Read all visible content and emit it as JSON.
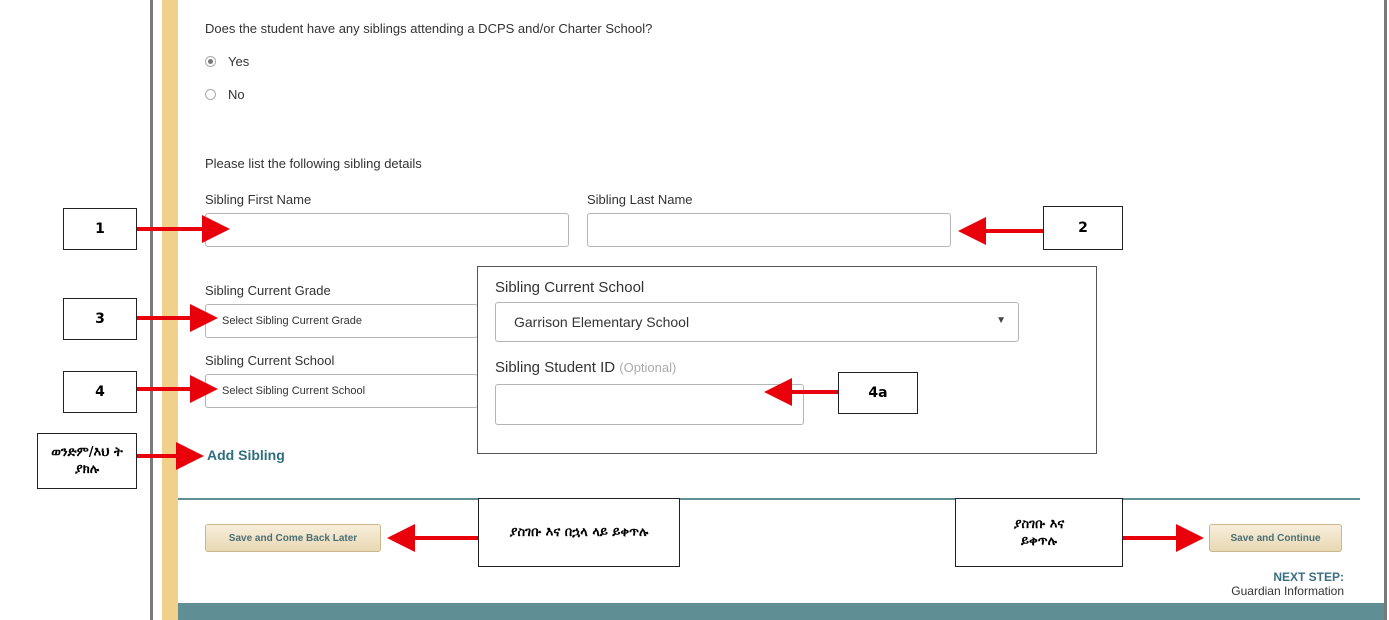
{
  "form": {
    "question": "Does the student have any siblings attending a DCPS and/or Charter School?",
    "options": [
      {
        "label": "Yes",
        "selected": true
      },
      {
        "label": "No",
        "selected": false
      }
    ],
    "list_prompt": "Please list the following sibling details",
    "first_name_label": "Sibling First Name",
    "first_name_value": "",
    "last_name_label": "Sibling Last Name",
    "last_name_value": "",
    "grade_label": "Sibling Current Grade",
    "grade_placeholder": "Select Sibling Current Grade",
    "school_label": "Sibling Current School",
    "school_placeholder": "Select Sibling Current School",
    "add_sibling": "Add Sibling"
  },
  "popup": {
    "school_label": "Sibling Current School",
    "school_value": "Garrison Elementary School",
    "student_id_label": "Sibling Student ID",
    "student_id_optional": "(Optional)",
    "student_id_value": ""
  },
  "buttons": {
    "save_later": "Save and Come Back Later",
    "save_continue": "Save and Continue"
  },
  "next_step": {
    "label": "NEXT STEP:",
    "value": "Guardian Information"
  },
  "callouts": {
    "c1": "1",
    "c2": "2",
    "c3": "3",
    "c4": "4",
    "c4a": "4a",
    "add_sibling": "ወንድም/እህ ት ያክሉ",
    "save_later": "ያስገቡ እና በኋላ ላይ ይቀጥሉ",
    "save_continue": "ያስገቡ እና ይቀጥሉ"
  },
  "colors": {
    "accent": "#2f6e7e",
    "gold_bar": "#f0d08a",
    "teal": "#5f8f95",
    "arrow": "#e8000b"
  }
}
